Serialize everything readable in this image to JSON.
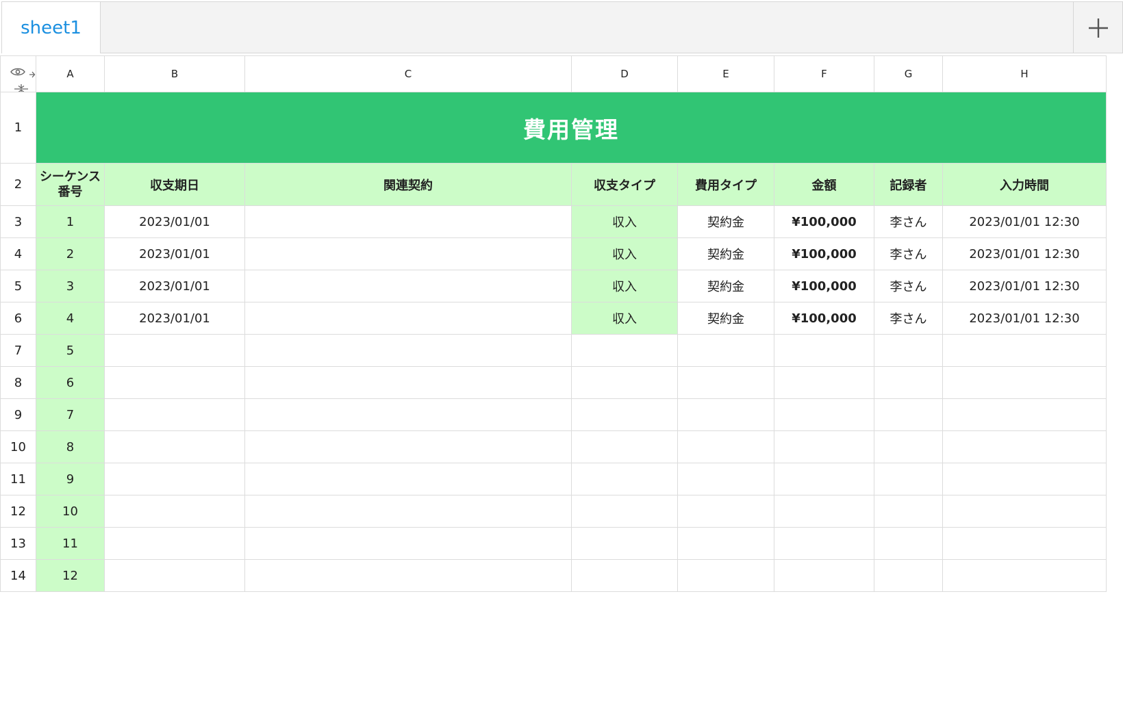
{
  "tabs": [
    {
      "label": "sheet1",
      "active": true
    }
  ],
  "add_sheet_icon": "plus-icon",
  "corner_icons": [
    "eye-icon",
    "collapse-columns-icon",
    "collapse-rows-icon"
  ],
  "columns": [
    "A",
    "B",
    "C",
    "D",
    "E",
    "F",
    "G",
    "H"
  ],
  "row_numbers": [
    "1",
    "2",
    "3",
    "4",
    "5",
    "6",
    "7",
    "8",
    "9",
    "10",
    "11",
    "12",
    "13",
    "14"
  ],
  "title": "費用管理",
  "headers": {
    "seq": "シーケンス番号",
    "date": "収支期日",
    "contract": "関連契約",
    "io_type": "収支タイプ",
    "cost_type": "費用タイプ",
    "amount": "金額",
    "recorder": "記録者",
    "input_time": "入力時間"
  },
  "rows": [
    {
      "seq": "1",
      "date": "2023/01/01",
      "contract": "",
      "io_type": "収入",
      "cost_type": "契約金",
      "amount": "¥100,000",
      "recorder": "李さん",
      "input_time": "2023/01/01 12:30"
    },
    {
      "seq": "2",
      "date": "2023/01/01",
      "contract": "",
      "io_type": "収入",
      "cost_type": "契約金",
      "amount": "¥100,000",
      "recorder": "李さん",
      "input_time": "2023/01/01 12:30"
    },
    {
      "seq": "3",
      "date": "2023/01/01",
      "contract": "",
      "io_type": "収入",
      "cost_type": "契約金",
      "amount": "¥100,000",
      "recorder": "李さん",
      "input_time": "2023/01/01 12:30"
    },
    {
      "seq": "4",
      "date": "2023/01/01",
      "contract": "",
      "io_type": "収入",
      "cost_type": "契約金",
      "amount": "¥100,000",
      "recorder": "李さん",
      "input_time": "2023/01/01 12:30"
    },
    {
      "seq": "5",
      "date": "",
      "contract": "",
      "io_type": "",
      "cost_type": "",
      "amount": "",
      "recorder": "",
      "input_time": ""
    },
    {
      "seq": "6",
      "date": "",
      "contract": "",
      "io_type": "",
      "cost_type": "",
      "amount": "",
      "recorder": "",
      "input_time": ""
    },
    {
      "seq": "7",
      "date": "",
      "contract": "",
      "io_type": "",
      "cost_type": "",
      "amount": "",
      "recorder": "",
      "input_time": ""
    },
    {
      "seq": "8",
      "date": "",
      "contract": "",
      "io_type": "",
      "cost_type": "",
      "amount": "",
      "recorder": "",
      "input_time": ""
    },
    {
      "seq": "9",
      "date": "",
      "contract": "",
      "io_type": "",
      "cost_type": "",
      "amount": "",
      "recorder": "",
      "input_time": ""
    },
    {
      "seq": "10",
      "date": "",
      "contract": "",
      "io_type": "",
      "cost_type": "",
      "amount": "",
      "recorder": "",
      "input_time": ""
    },
    {
      "seq": "11",
      "date": "",
      "contract": "",
      "io_type": "",
      "cost_type": "",
      "amount": "",
      "recorder": "",
      "input_time": ""
    },
    {
      "seq": "12",
      "date": "",
      "contract": "",
      "io_type": "",
      "cost_type": "",
      "amount": "",
      "recorder": "",
      "input_time": ""
    }
  ],
  "colors": {
    "title_bg": "#31c574",
    "header_bg": "#ccfcc8",
    "tab_text": "#1a8fe0"
  }
}
